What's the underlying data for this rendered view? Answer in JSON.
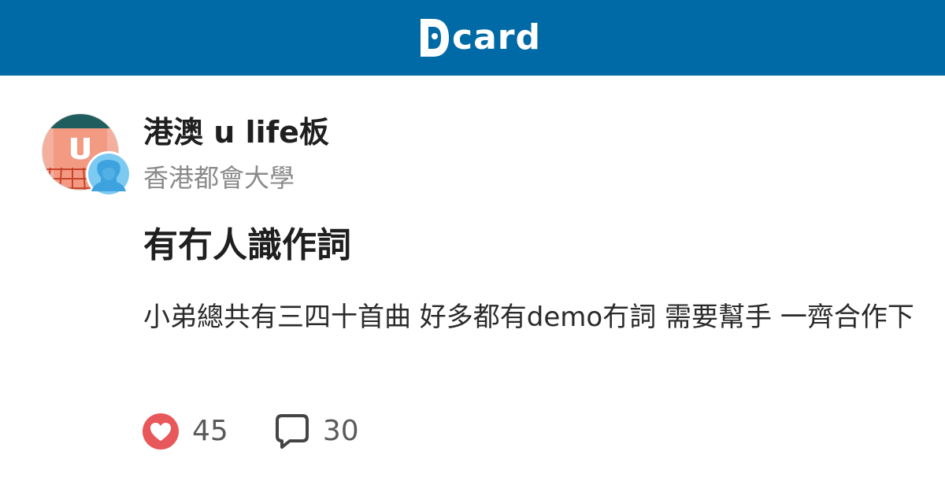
{
  "brand": {
    "logo_text": "card",
    "logo_icon": "dcard-logo-icon",
    "bar_color": "#006aa6"
  },
  "post": {
    "forum": "港澳 u life板",
    "school": "香港都會大學",
    "title": "有冇人識作詞",
    "excerpt": "小弟總共有三四十首曲 好多都有demo冇詞 需要幫手 一齊合作下",
    "avatar_icon": "forum-avatar-icon",
    "author_icon": "anonymous-user-icon"
  },
  "stats": {
    "likes": "45",
    "comments": "30",
    "like_icon": "heart-icon",
    "comment_icon": "comment-icon",
    "like_color": "#e8575a"
  }
}
